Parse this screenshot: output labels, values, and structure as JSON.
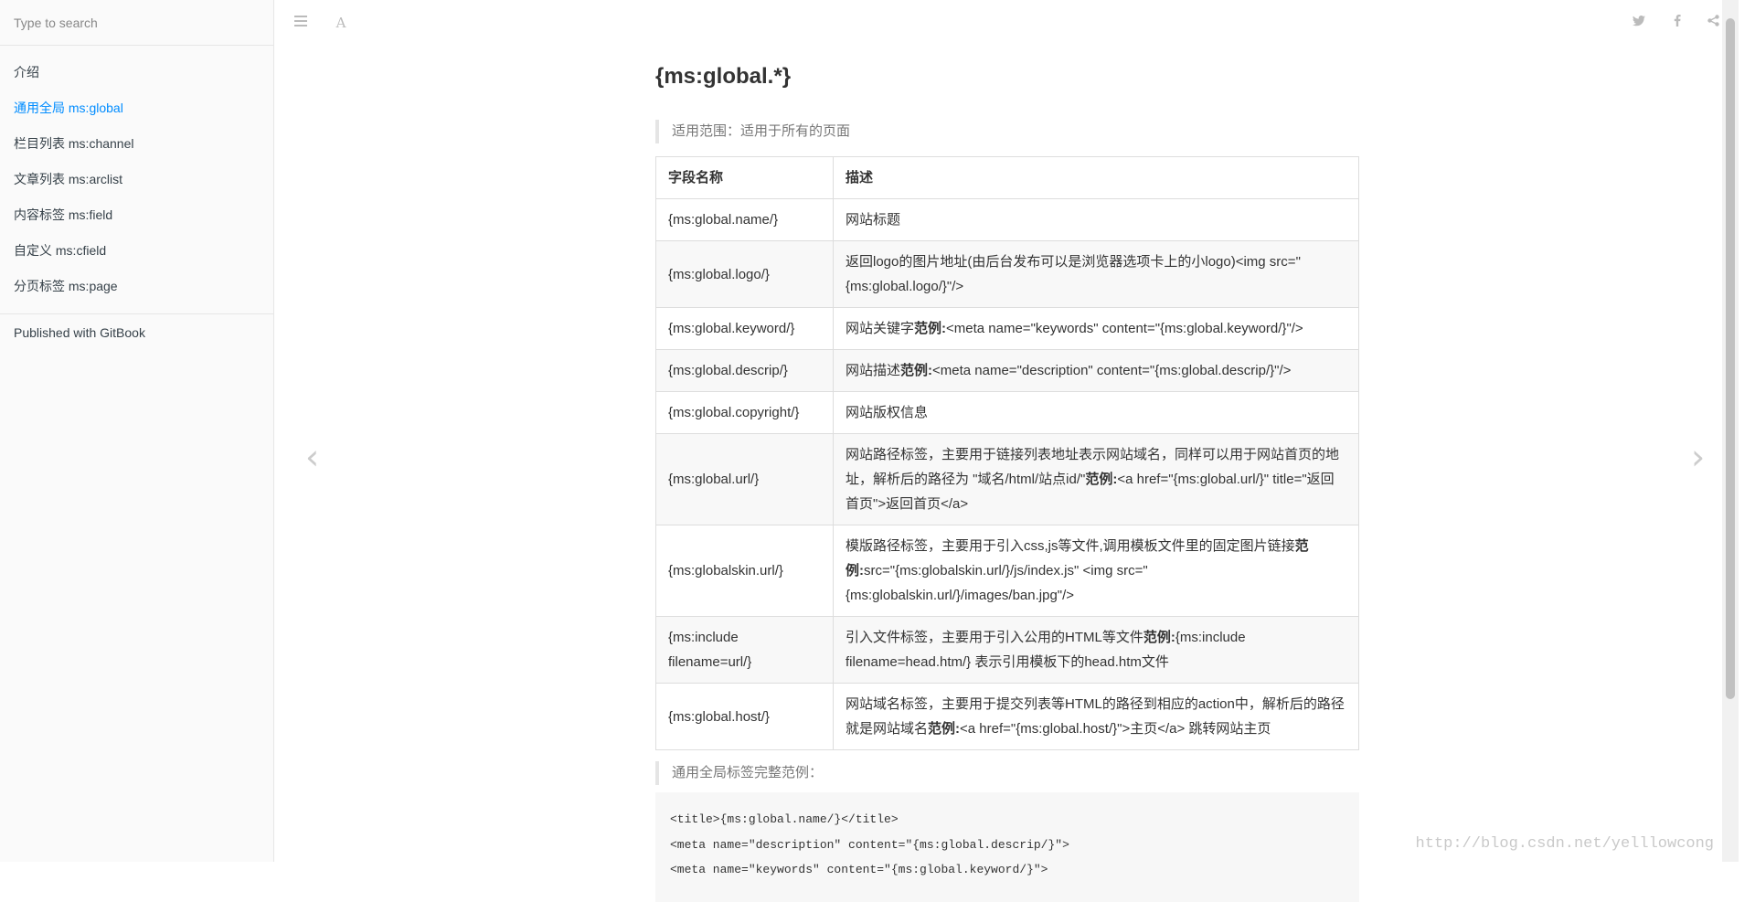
{
  "sidebar": {
    "search_placeholder": "Type to search",
    "items": [
      {
        "label": "介绍"
      },
      {
        "label": "通用全局 ms:global"
      },
      {
        "label": "栏目列表 ms:channel"
      },
      {
        "label": "文章列表 ms:arclist"
      },
      {
        "label": "内容标签 ms:field"
      },
      {
        "label": "自定义 ms:cfield"
      },
      {
        "label": "分页标签 ms:page"
      }
    ],
    "active_index": 1,
    "published": "Published with GitBook"
  },
  "topbar": {
    "menu_icon": "hamburger-icon",
    "font_icon": "font-settings-icon",
    "right_icons": [
      "twitter-icon",
      "facebook-icon",
      "share-icon"
    ]
  },
  "nav": {
    "prev_icon": "chevron-left-icon",
    "next_icon": "chevron-right-icon"
  },
  "page": {
    "title": "{ms:global.*}",
    "scope_note": "适用范围：适用于所有的页面",
    "example_note": "通用全局标签完整范例："
  },
  "table": {
    "headers": [
      "字段名称",
      "描述"
    ],
    "rows": [
      {
        "field": "{ms:global.name/}",
        "desc": "网站标题"
      },
      {
        "field": "{ms:global.logo/}",
        "desc": "返回logo的图片地址(由后台发布可以是浏览器选项卡上的小logo)<img src=\"{ms:global.logo/}\"/>"
      },
      {
        "field": "{ms:global.keyword/}",
        "desc_pre": "网站关键字",
        "desc_strong": "范例:",
        "desc_post": "<meta name=\"keywords\" content=\"{ms:global.keyword/}\"/>"
      },
      {
        "field": "{ms:global.descrip/}",
        "desc_pre": "网站描述",
        "desc_strong": "范例:",
        "desc_post": "<meta name=\"description\" content=\"{ms:global.descrip/}\"/>"
      },
      {
        "field": "{ms:global.copyright/}",
        "desc": "网站版权信息"
      },
      {
        "field": "{ms:global.url/}",
        "desc_pre": "网站路径标签，主要用于链接列表地址表示网站域名，同样可以用于网站首页的地址，解析后的路径为 \"域名/html/站点id/\"",
        "desc_strong": "范例:",
        "desc_post": "<a href=\"{ms:global.url/}\" title=\"返回首页\">返回首页</a>"
      },
      {
        "field": "{ms:globalskin.url/}",
        "desc_pre": "模版路径标签，主要用于引入css,js等文件,调用模板文件里的固定图片链接",
        "desc_strong": "范例:",
        "desc_post": "src=\"{ms:globalskin.url/}/js/index.js\" <img src=\"{ms:globalskin.url/}/images/ban.jpg\"/>"
      },
      {
        "field": "{ms:include filename=url/}",
        "desc_pre": "引入文件标签，主要用于引入公用的HTML等文件",
        "desc_strong": "范例:",
        "desc_post": "{ms:include filename=head.htm/} 表示引用模板下的head.htm文件"
      },
      {
        "field": "{ms:global.host/}",
        "desc_pre": "网站域名标签，主要用于提交列表等HTML的路径到相应的action中，解析后的路径就是网站域名",
        "desc_strong": "范例:",
        "desc_post": "<a href=\"{ms:global.host/}\">主页</a> 跳转网站主页"
      }
    ]
  },
  "code": {
    "lines": [
      "<title>{ms:global.name/}</title>",
      "<meta name=\"description\" content=\"{ms:global.descrip/}\">",
      "<meta name=\"keywords\" content=\"{ms:global.keyword/}\">"
    ]
  },
  "watermark": "http://blog.csdn.net/yelllowcong"
}
